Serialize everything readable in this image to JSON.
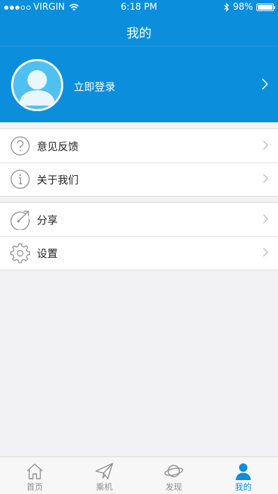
{
  "status_bar": {
    "carrier": "VIRGIN",
    "time": "6:18 PM",
    "battery": "98%",
    "battery_level": 0.98
  },
  "nav": {
    "title": "我的"
  },
  "profile": {
    "login_label": "立即登录",
    "avatar_icon": "user-avatar-icon"
  },
  "menu_group_1": [
    {
      "label": "意见反馈",
      "icon": "question-circle-icon"
    },
    {
      "label": "关于我们",
      "icon": "info-circle-icon"
    }
  ],
  "menu_group_2": [
    {
      "label": "分享",
      "icon": "share-arrow-icon"
    },
    {
      "label": "设置",
      "icon": "gear-icon"
    }
  ],
  "tabs": [
    {
      "label": "首页",
      "icon": "home-icon",
      "active": false
    },
    {
      "label": "乘机",
      "icon": "paper-plane-icon",
      "active": false
    },
    {
      "label": "发现",
      "icon": "planet-icon",
      "active": false
    },
    {
      "label": "我的",
      "icon": "person-icon",
      "active": true
    }
  ],
  "colors": {
    "accent": "#0b8fdc",
    "background": "#f2f2f4",
    "tab_inactive": "#8e8e8e"
  }
}
